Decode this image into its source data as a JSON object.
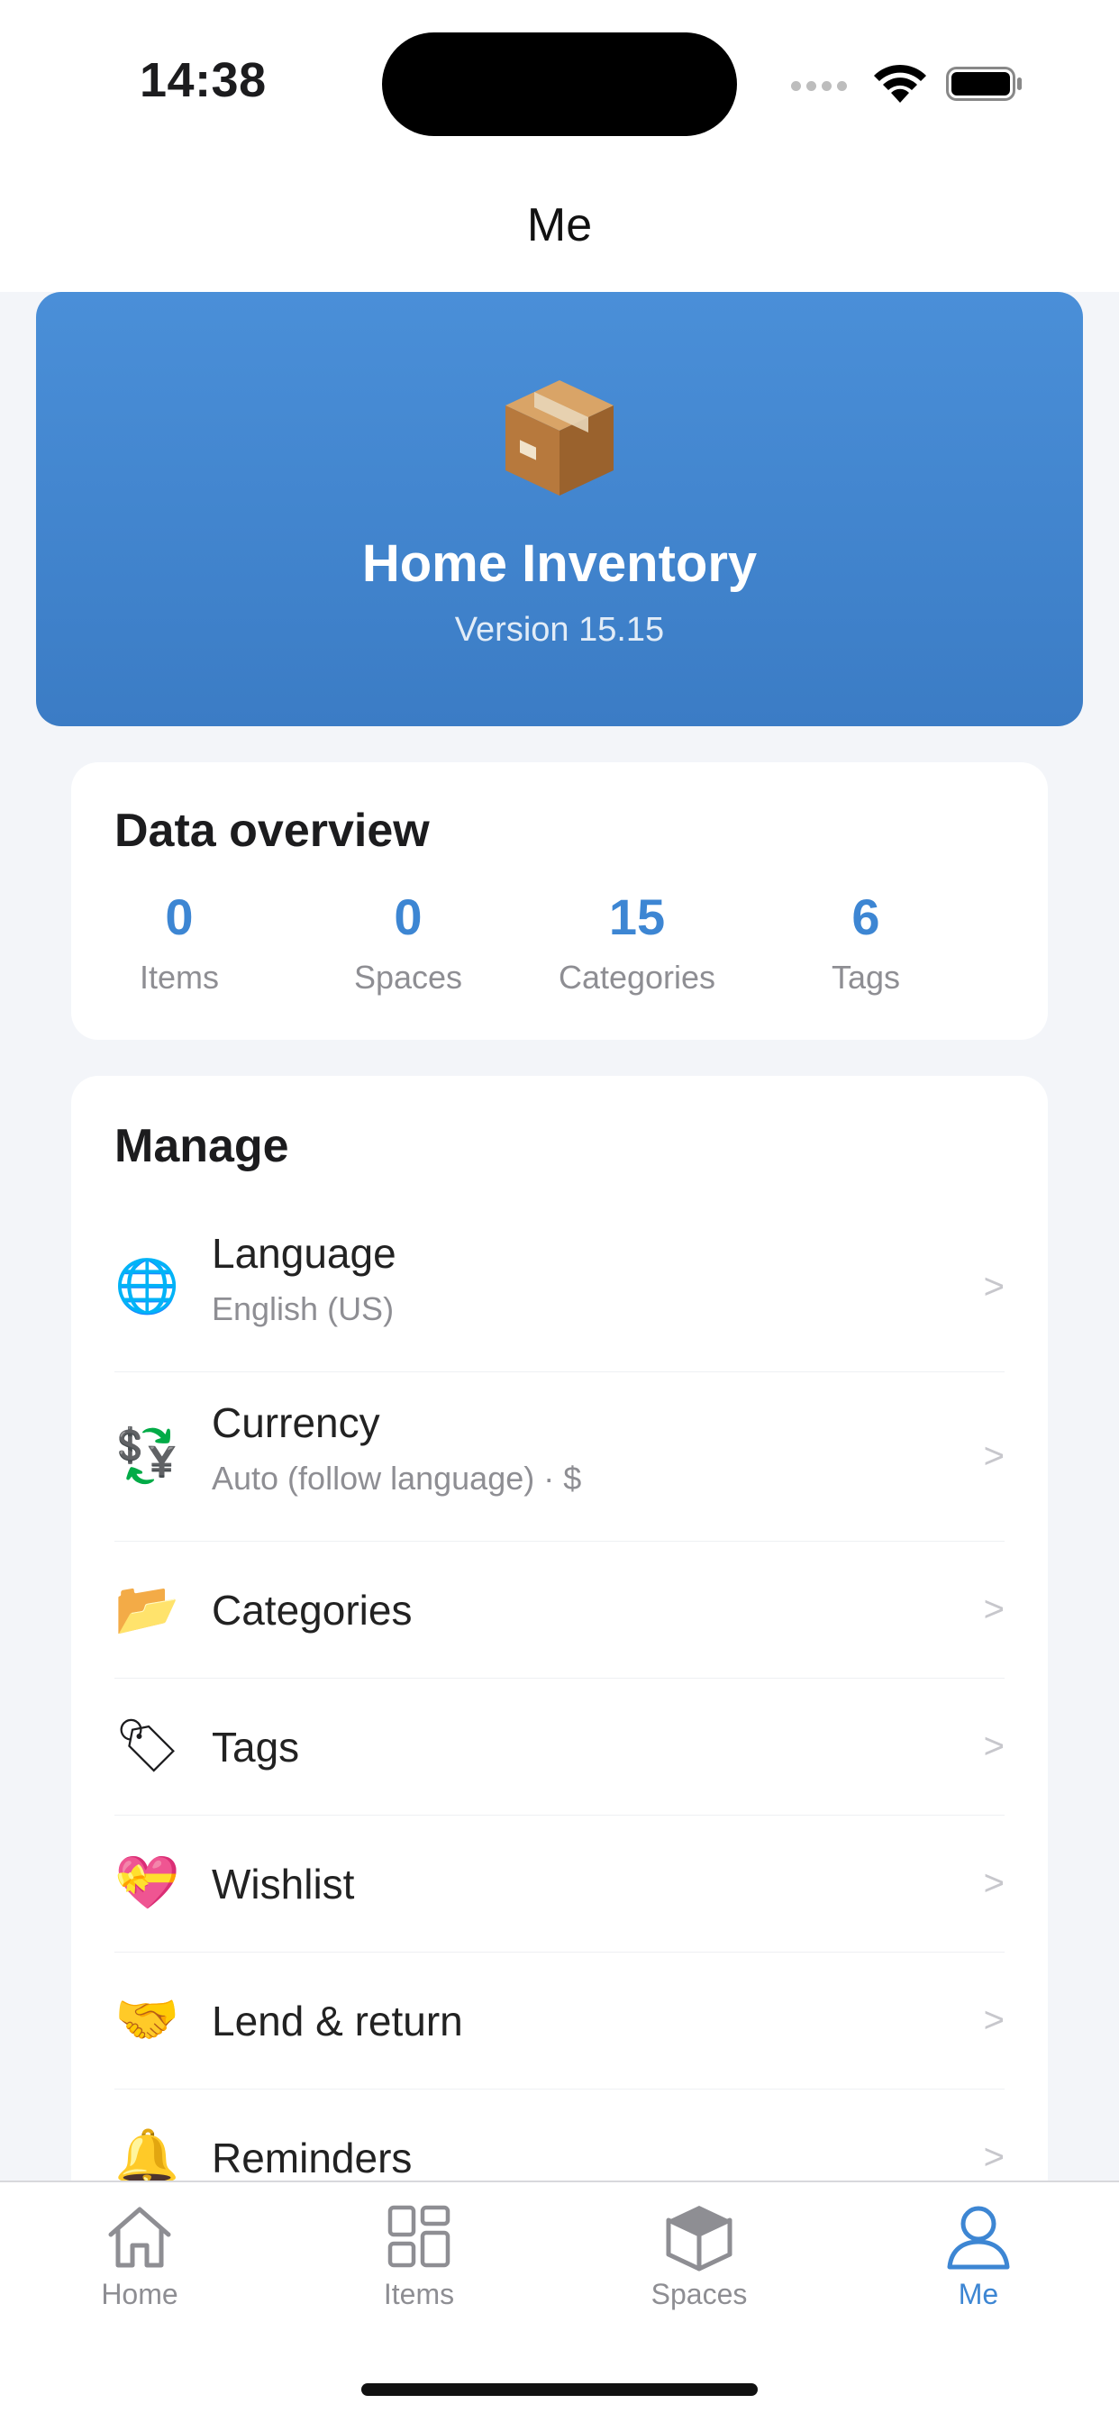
{
  "status_bar": {
    "time": "14:38"
  },
  "nav": {
    "title": "Me"
  },
  "hero": {
    "icon": "package-icon",
    "app_name": "Home Inventory",
    "version": "Version 15.15",
    "gradient_top": "#4a8fd8",
    "gradient_bottom": "#3b7cc5"
  },
  "overview": {
    "title": "Data overview",
    "stats": [
      {
        "value": "0",
        "label": "Items"
      },
      {
        "value": "0",
        "label": "Spaces"
      },
      {
        "value": "15",
        "label": "Categories"
      },
      {
        "value": "6",
        "label": "Tags"
      }
    ],
    "accent_color": "#3d86d3"
  },
  "manage": {
    "title": "Manage",
    "items": [
      {
        "icon": "globe-icon",
        "glyph": "🌐",
        "title": "Language",
        "subtitle": "English (US)",
        "chevron": ">"
      },
      {
        "icon": "currency-exchange-icon",
        "glyph": "💱",
        "title": "Currency",
        "subtitle": "Auto (follow language) · $",
        "chevron": ">"
      },
      {
        "icon": "folder-icon",
        "glyph": "📂",
        "title": "Categories",
        "subtitle": "",
        "chevron": ">"
      },
      {
        "icon": "tag-icon",
        "glyph": "🏷",
        "title": "Tags",
        "subtitle": "",
        "chevron": ">"
      },
      {
        "icon": "heart-gift-icon",
        "glyph": "💝",
        "title": "Wishlist",
        "subtitle": "",
        "chevron": ">"
      },
      {
        "icon": "handshake-icon",
        "glyph": "🤝",
        "title": "Lend & return",
        "subtitle": "",
        "chevron": ">"
      },
      {
        "icon": "bell-icon",
        "glyph": "🔔",
        "title": "Reminders",
        "subtitle": "",
        "chevron": ">"
      }
    ]
  },
  "tabbar": {
    "tabs": [
      {
        "icon": "home-icon",
        "label": "Home",
        "active": false
      },
      {
        "icon": "grid-icon",
        "label": "Items",
        "active": false
      },
      {
        "icon": "cube-icon",
        "label": "Spaces",
        "active": false
      },
      {
        "icon": "person-icon",
        "label": "Me",
        "active": true
      }
    ],
    "active_color": "#3d86d3",
    "inactive_color": "#8e8e93"
  }
}
